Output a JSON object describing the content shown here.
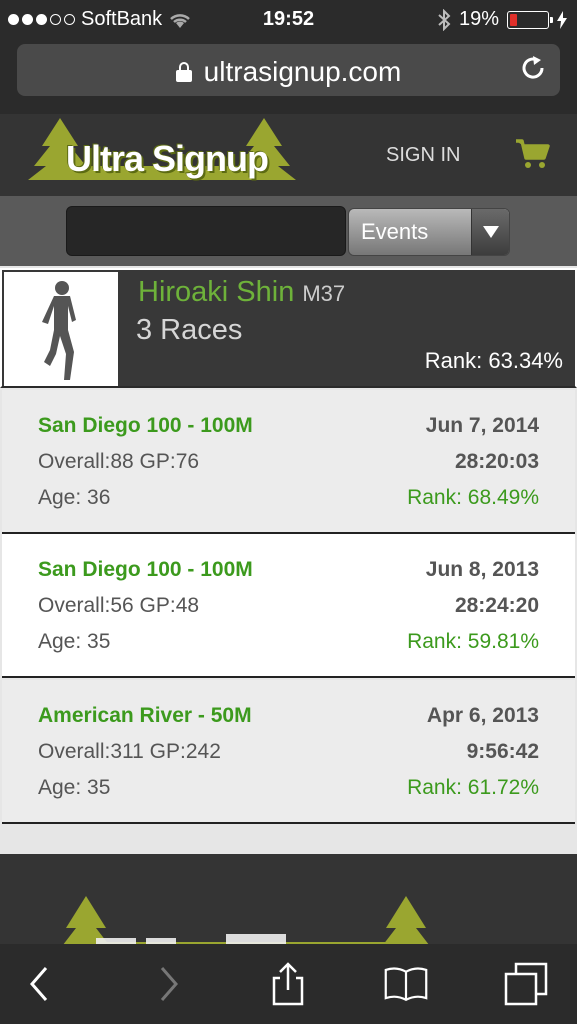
{
  "status_bar": {
    "carrier": "SoftBank",
    "time": "19:52",
    "battery_percent": "19%",
    "battery_level": 0.19
  },
  "browser": {
    "url": "ultrasignup.com"
  },
  "header": {
    "logo_text": "Ultra Signup",
    "sign_in_label": "SIGN IN"
  },
  "search": {
    "query": "",
    "select_value": "Events"
  },
  "profile": {
    "name": "Hiroaki Shin",
    "age_group": "M37",
    "races_count": "3 Races",
    "rank": "Rank: 63.34%"
  },
  "races": [
    {
      "name": "San Diego 100 - 100M",
      "date": "Jun 7, 2014",
      "overall": "Overall:88 GP:76",
      "time": "28:20:03",
      "age": "Age: 36",
      "rank": "Rank: 68.49%"
    },
    {
      "name": "San Diego 100 - 100M",
      "date": "Jun 8, 2013",
      "overall": "Overall:56 GP:48",
      "time": "28:24:20",
      "age": "Age: 35",
      "rank": "Rank: 59.81%"
    },
    {
      "name": "American River - 50M",
      "date": "Apr 6, 2013",
      "overall": "Overall:311 GP:242",
      "time": "9:56:42",
      "age": "Age: 35",
      "rank": "Rank: 61.72%"
    }
  ],
  "colors": {
    "brand_green": "#3c9a1d",
    "logo_olive": "#9aa630",
    "header_dark": "#343434"
  }
}
